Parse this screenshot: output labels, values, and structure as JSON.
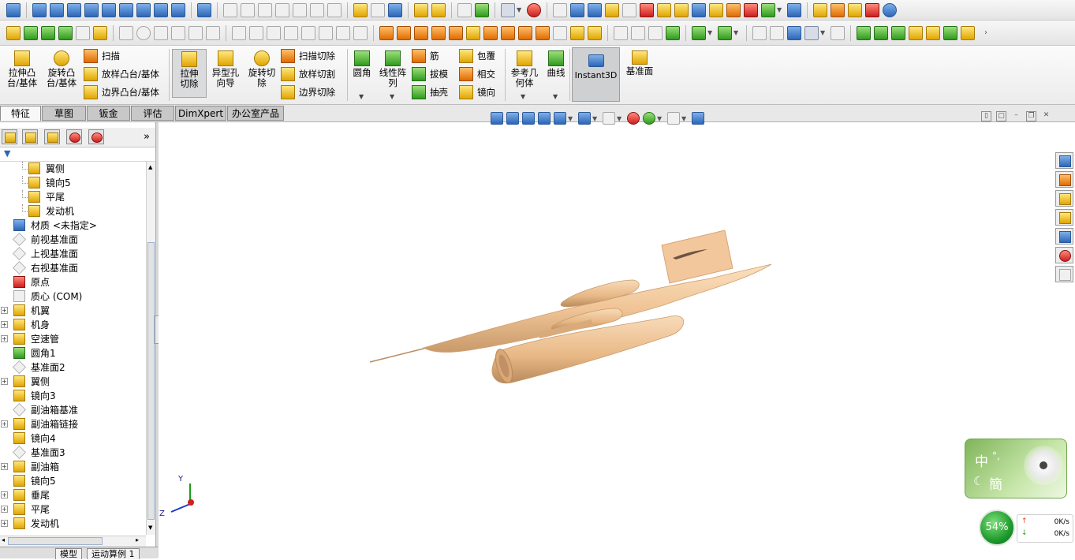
{
  "ribbon": {
    "extrude_boss": "拉伸凸台/基体",
    "revolve_boss": "旋转凸台/基体",
    "sweep": "扫描",
    "loft_boss": "放样凸台/基体",
    "boundary_boss": "边界凸台/基体",
    "extrude_cut": "拉伸切除",
    "hole_wizard": "异型孔向导",
    "revolve_cut": "旋转切除",
    "swept_cut": "扫描切除",
    "lofted_cut": "放样切割",
    "boundary_cut": "边界切除",
    "fillet": "圆角",
    "linear_pattern": "线性阵列",
    "rib": "筋",
    "draft": "拔模",
    "shell": "抽壳",
    "wrap": "包覆",
    "intersect": "相交",
    "mirror": "镜向",
    "ref_geometry": "参考几何体",
    "curves": "曲线",
    "instant3d": "Instant3D",
    "plane": "基准面"
  },
  "tabs": [
    "特征",
    "草图",
    "钣金",
    "评估",
    "DimXpert",
    "办公室产品"
  ],
  "tabs_active": "特征",
  "tree": [
    {
      "label": "翼侧",
      "icon": "feature-folder-icon",
      "indent": 2,
      "expand": false
    },
    {
      "label": "镜向5",
      "icon": "feature-folder-icon",
      "indent": 2,
      "expand": false
    },
    {
      "label": "平尾",
      "icon": "feature-folder-icon",
      "indent": 2,
      "expand": false
    },
    {
      "label": "发动机",
      "icon": "feature-folder-icon",
      "indent": 2,
      "expand": false
    },
    {
      "label": "材质 <未指定>",
      "icon": "material-icon",
      "indent": 1,
      "expand": false
    },
    {
      "label": "前视基准面",
      "icon": "plane-icon",
      "indent": 1,
      "expand": false
    },
    {
      "label": "上视基准面",
      "icon": "plane-icon",
      "indent": 1,
      "expand": false
    },
    {
      "label": "右视基准面",
      "icon": "plane-icon",
      "indent": 1,
      "expand": false
    },
    {
      "label": "原点",
      "icon": "origin-icon",
      "indent": 1,
      "expand": false
    },
    {
      "label": "质心 (COM)",
      "icon": "center-of-mass-icon",
      "indent": 1,
      "expand": false
    },
    {
      "label": "机翼",
      "icon": "extrude-icon",
      "indent": 1,
      "expand": true
    },
    {
      "label": "机身",
      "icon": "revolve-icon",
      "indent": 1,
      "expand": true
    },
    {
      "label": "空速管",
      "icon": "extrude-icon",
      "indent": 1,
      "expand": true
    },
    {
      "label": "圆角1",
      "icon": "fillet-icon",
      "indent": 1,
      "expand": false
    },
    {
      "label": "基准面2",
      "icon": "plane-icon",
      "indent": 1,
      "expand": false
    },
    {
      "label": "翼侧",
      "icon": "revolve-icon",
      "indent": 1,
      "expand": true
    },
    {
      "label": "镜向3",
      "icon": "mirror-icon",
      "indent": 1,
      "expand": false
    },
    {
      "label": "副油箱基准",
      "icon": "plane-icon",
      "indent": 1,
      "expand": false
    },
    {
      "label": "副油箱链接",
      "icon": "extrude-icon",
      "indent": 1,
      "expand": true
    },
    {
      "label": "镜向4",
      "icon": "mirror-icon",
      "indent": 1,
      "expand": false
    },
    {
      "label": "基准面3",
      "icon": "plane-icon",
      "indent": 1,
      "expand": false
    },
    {
      "label": "副油箱",
      "icon": "revolve-icon",
      "indent": 1,
      "expand": true
    },
    {
      "label": "镜向5",
      "icon": "mirror-icon",
      "indent": 1,
      "expand": false
    },
    {
      "label": "垂尾",
      "icon": "extrude-icon",
      "indent": 1,
      "expand": true
    },
    {
      "label": "平尾",
      "icon": "extrude-icon",
      "indent": 1,
      "expand": true
    },
    {
      "label": "发动机",
      "icon": "revolve-icon",
      "indent": 1,
      "expand": true
    }
  ],
  "bottom_tabs": [
    "模型",
    "运动算例 1"
  ],
  "triad": {
    "y": "Y",
    "z": "Z"
  },
  "ime": {
    "lang": "中",
    "mode": "簡",
    "punct": "°,"
  },
  "net": {
    "cpu": "54%",
    "up": "0K/s",
    "down": "0K/s"
  },
  "colors": {
    "model": "#f0c597",
    "selection_blue": "#2c66b8",
    "ime_green": "#6ea64b"
  }
}
